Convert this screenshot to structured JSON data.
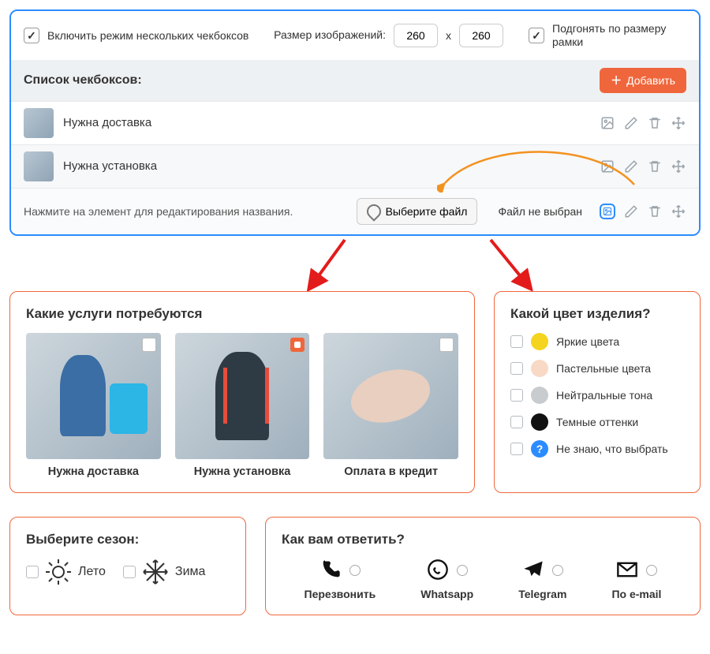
{
  "settings": {
    "enable_multi_label": "Включить режим нескольких чекбоксов",
    "enable_multi_checked": true,
    "size_label": "Размер изображений:",
    "size_w": "260",
    "size_x": "x",
    "size_h": "260",
    "fit_label": "Подгонять по размеру рамки",
    "fit_checked": true
  },
  "list": {
    "title": "Список чекбоксов:",
    "add_label": "Добавить",
    "rows": [
      {
        "title": "Нужна доставка"
      },
      {
        "title": "Нужна установка"
      }
    ],
    "edit": {
      "hint": "Нажмите на элемент для редактирования названия.",
      "file_btn": "Выберите файл",
      "file_status": "Файл не выбран"
    }
  },
  "services": {
    "title": "Какие услуги потребуются",
    "items": [
      {
        "caption": "Нужна доставка",
        "checked": false
      },
      {
        "caption": "Нужна установка",
        "checked": true
      },
      {
        "caption": "Оплата в кредит",
        "checked": false
      }
    ]
  },
  "colors": {
    "title": "Какой цвет изделия?",
    "items": [
      {
        "label": "Яркие цвета"
      },
      {
        "label": "Пастельные цвета"
      },
      {
        "label": "Нейтральные тона"
      },
      {
        "label": "Темные оттенки"
      },
      {
        "label": "Не знаю, что выбрать"
      }
    ]
  },
  "season": {
    "title": "Выберите сезон:",
    "opt_summer": "Лето",
    "opt_winter": "Зима"
  },
  "reply": {
    "title": "Как вам ответить?",
    "opts": [
      {
        "label": "Перезвонить"
      },
      {
        "label": "Whatsapp"
      },
      {
        "label": "Telegram"
      },
      {
        "label": "По e-mail"
      }
    ]
  },
  "colors_hex": {
    "blue_border": "#2b8cff",
    "orange_accent": "#f0663c"
  }
}
